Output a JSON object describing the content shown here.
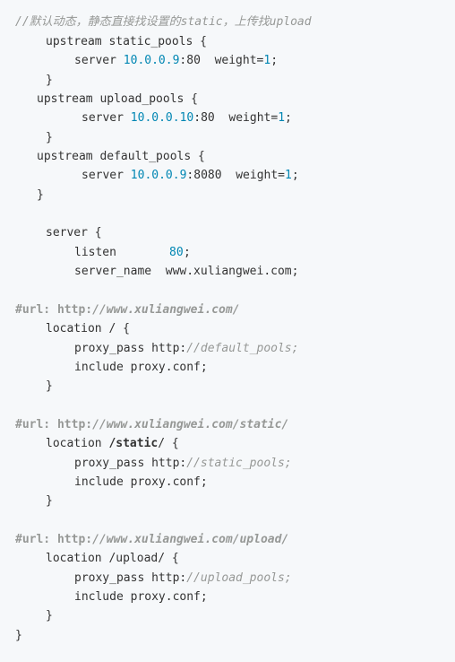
{
  "code": {
    "comment_top": "//默认动态，静态直接找设置的static，上传找upload",
    "upstream_static_open": "upstream static_pools {",
    "server_kw": "server ",
    "ip_static": "10.0.0.9",
    "port_80": ":80",
    "weight_kw": "weight=",
    "weight_val": "1",
    "semicolon": ";",
    "close_brace": "}",
    "upstream_upload_open": "upstream upload_pools {",
    "ip_upload": "10.0.0.10",
    "upstream_default_open": "upstream default_pools {",
    "ip_default": "10.0.0.9",
    "port_8080": ":8080",
    "server_block_open": "server {",
    "listen_kw": "listen",
    "listen_port": "80",
    "server_name_line": "server_name  www.xuliangwei.com;",
    "url_kw": "#url: ",
    "url_scheme": "http:",
    "url_root_path": "//www.xuliangwei.com/",
    "url_static_path": "//www.xuliangwei.com/static/",
    "url_upload_path": "//www.xuliangwei.com/upload/",
    "location_root_open": "location / {",
    "proxy_pass_kw": "proxy_pass http:",
    "default_pools_ref": "//default_pools;",
    "include_line": "include proxy.conf;",
    "location_kw": "location ",
    "static_prefix": "/",
    "static_word": "static",
    "static_suffix": "/ {",
    "static_pools_ref": "//static_pools;",
    "location_upload_open": "location /upload/ {",
    "upload_pools_ref": "//upload_pools;"
  }
}
